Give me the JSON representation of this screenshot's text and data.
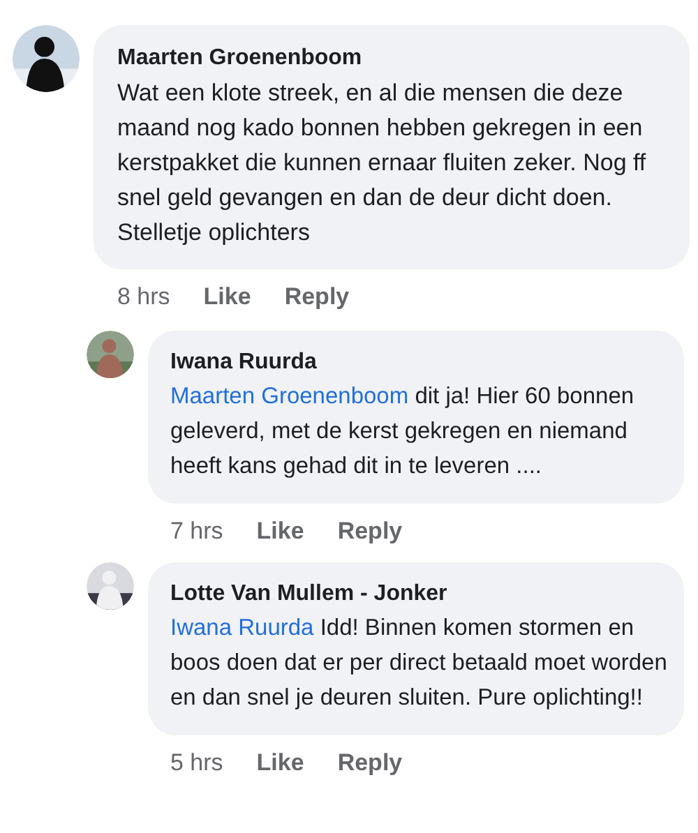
{
  "comments": [
    {
      "author": "Maarten Groenenboom",
      "text": "Wat een klote streek, en al die mensen die deze maand nog kado bonnen hebben gekregen in een kerstpakket die kunnen ernaar fluiten zeker. Nog ff snel geld gevangen en dan de deur dicht doen. Stelletje oplichters",
      "time": "8 hrs",
      "like": "Like",
      "reply": "Reply",
      "children": [
        {
          "author": "Iwana Ruurda",
          "mention": "Maarten Groenenboom",
          "text": "dit ja! Hier 60 bonnen geleverd, met de kerst gekregen en niemand heeft kans gehad dit in te leveren ....",
          "time": "7 hrs",
          "like": "Like",
          "reply": "Reply"
        },
        {
          "author": "Lotte Van Mullem - Jonker",
          "mention": "Iwana Ruurda",
          "text": "Idd! Binnen komen stormen en boos doen dat er per direct betaald moet worden en dan snel je deuren sluiten. Pure oplichting!!",
          "time": "5 hrs",
          "like": "Like",
          "reply": "Reply"
        }
      ]
    }
  ]
}
